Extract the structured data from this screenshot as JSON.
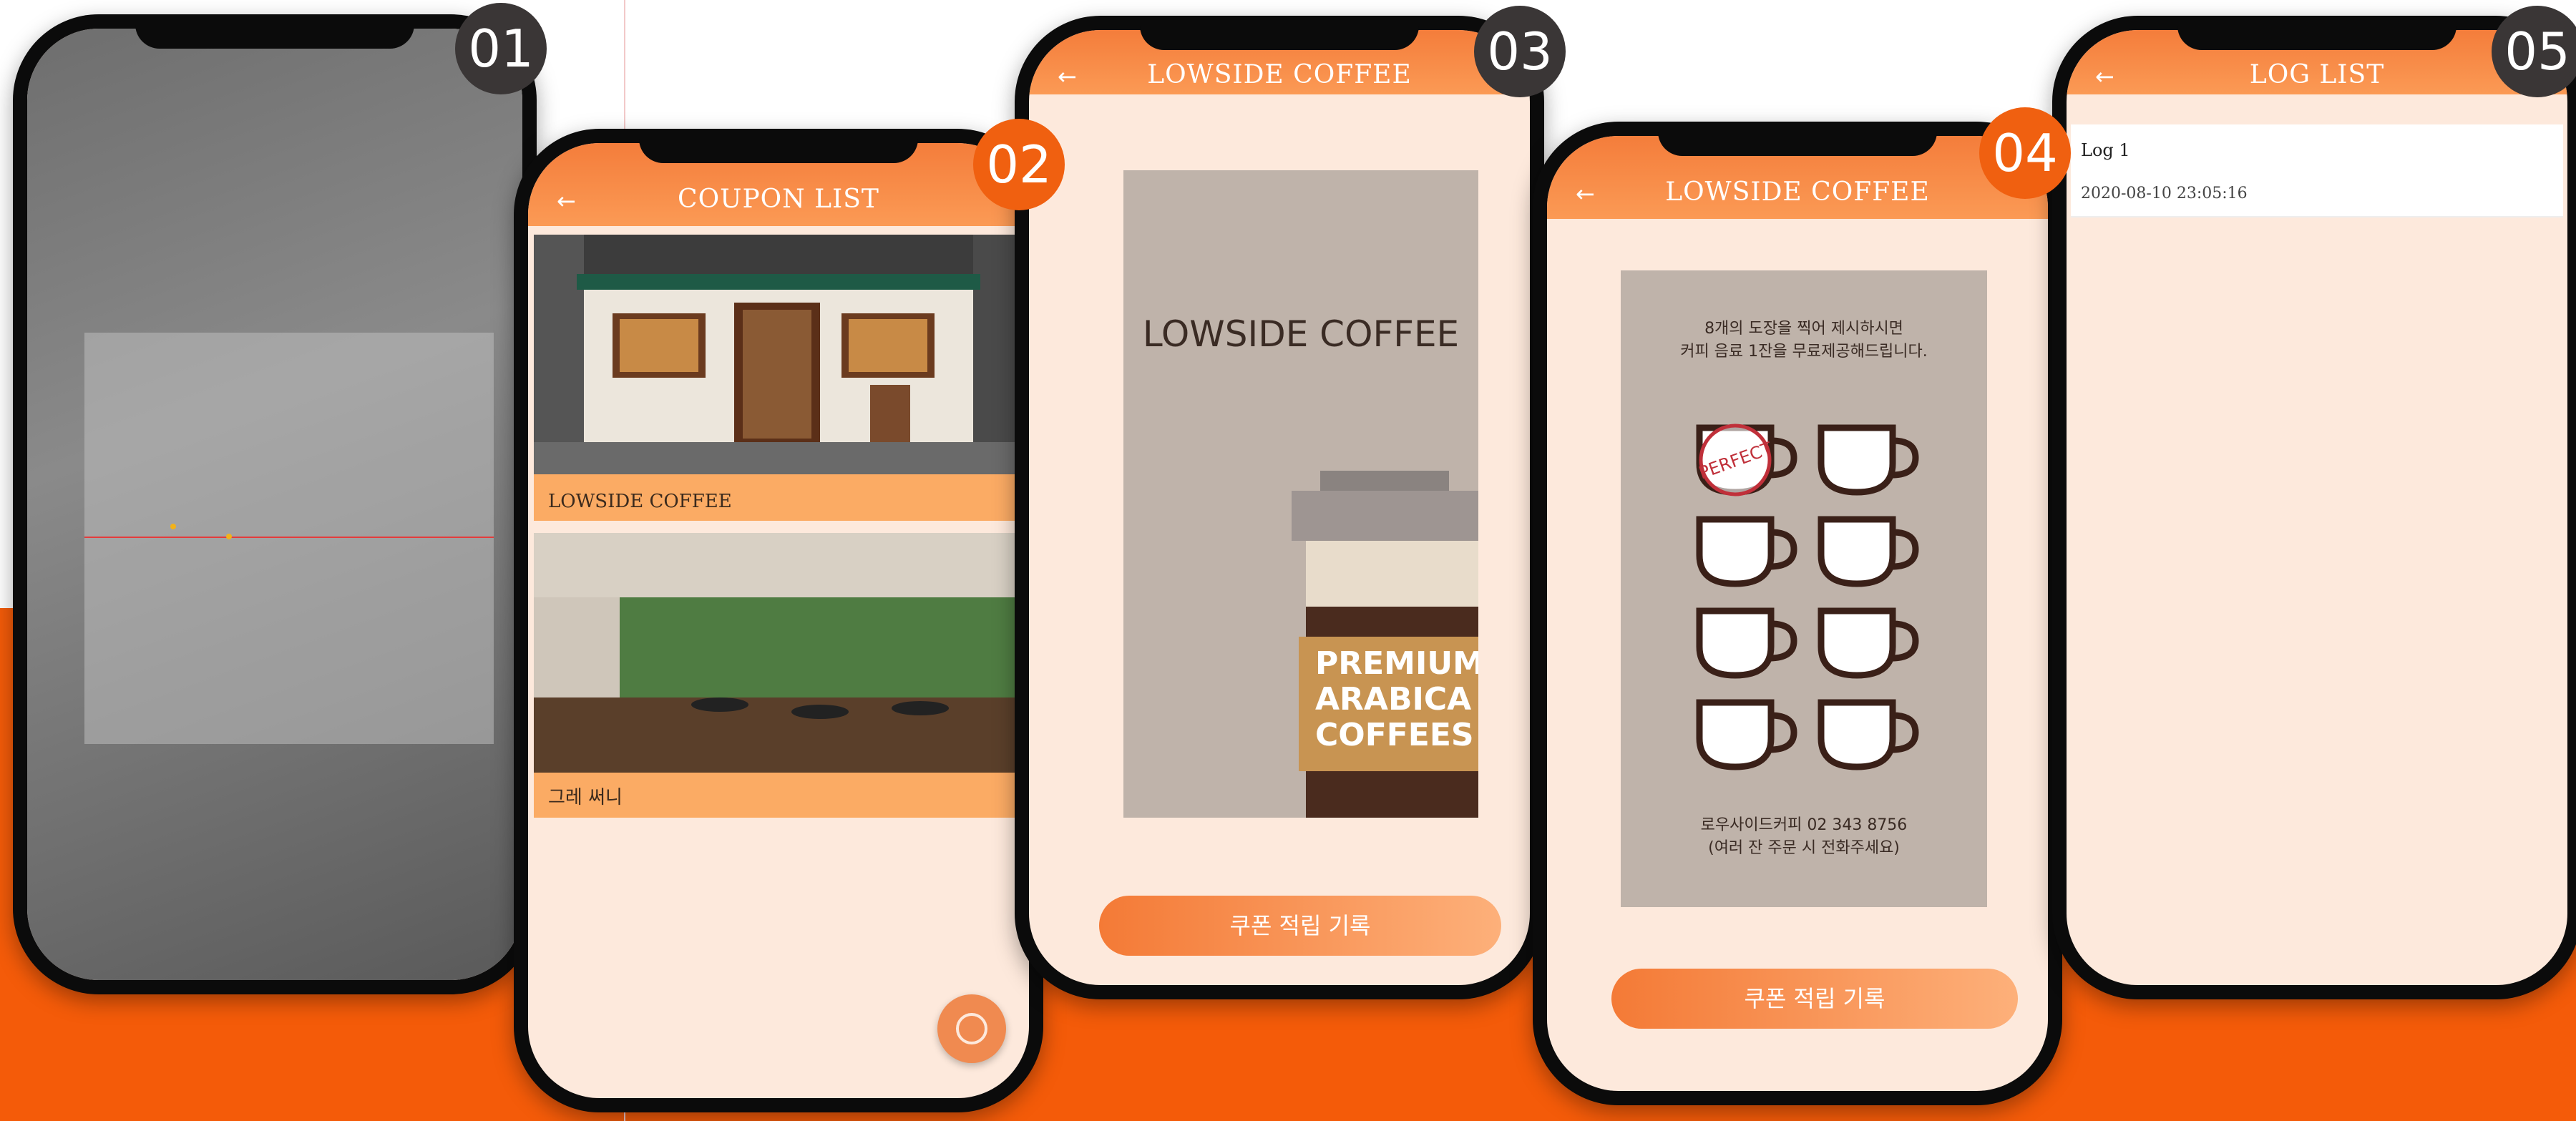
{
  "screens": [
    {
      "badge": "01"
    },
    {
      "badge": "02",
      "title": "COUPON LIST",
      "items": [
        {
          "label": "LOWSIDE COFFEE"
        },
        {
          "label": "그레 써니"
        }
      ]
    },
    {
      "badge": "03",
      "title": "LOWSIDE COFFEE",
      "brand": "LOWSIDE COFFEE",
      "cup_lines": [
        "PREMIUM",
        "ARABICA",
        "COFFEES"
      ],
      "button": "쿠폰 적립 기록"
    },
    {
      "badge": "04",
      "title": "LOWSIDE COFFEE",
      "coupon_text_top": [
        "8개의 도장을 찍어 제시하시면",
        "커피 음료 1잔을 무료제공해드립니다."
      ],
      "stamp_label": "PERFECT",
      "coupon_text_bottom": [
        "로우사이드커피 02 343 8756",
        "(여러 잔 주문 시 전화주세요)"
      ],
      "button": "쿠폰 적립 기록",
      "stamps_total": 8,
      "stamps_filled": 1
    },
    {
      "badge": "05",
      "title": "LOG LIST",
      "logs": [
        {
          "name": "Log 1",
          "time": "2020-08-10 23:05:16"
        }
      ]
    }
  ],
  "icons": {
    "back": "back-arrow-icon"
  },
  "colors": {
    "accent": "#f45b09",
    "header": "#f47d3b",
    "screen_bg": "#fde9dc",
    "card": "#fbab64",
    "badge_dark": "#3a3636",
    "badge_orange": "#f06010"
  }
}
